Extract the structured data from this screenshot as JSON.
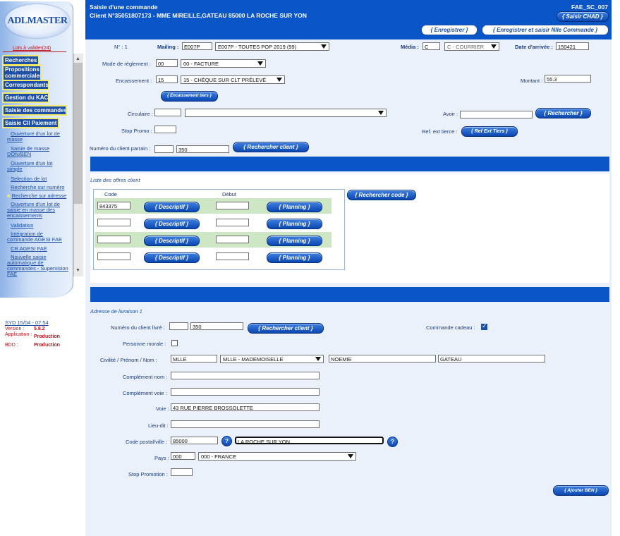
{
  "sidebar": {
    "logo_text": "ADLMASTER",
    "lots_link": "Lots à valider(24)",
    "nav": [
      "Recherches",
      "Propositions commerciales",
      "Correspondants",
      "Gestion du KAC",
      "Saisie des commandes",
      "Saisie Cll Paiement"
    ],
    "links": [
      "Ouverture d'un lot de masse",
      "Saisie de masse DON/BEN",
      "Ouverture d'un lot simple",
      "Selection de lot",
      "Recherche sur numéro",
      "Recherche sur adresse",
      "Ouverture d'un lot de saisie en masse des encaissements",
      "Validation",
      "Intégration de commande AGESI FAE",
      "CR AGESI FAE",
      "Nouvelle saisie automatique de commandes - Supervision FAE"
    ],
    "session": "SYD 15/04 - 07:54",
    "version_label": "Version :",
    "version_value": "5.8.2",
    "application_label": "Application :",
    "application_value": "Production",
    "bdd_label": "BDD :",
    "bdd_value": "Production"
  },
  "header": {
    "title": "Saisie d'une commande",
    "client": "Client N°35051807173 - MME MIREILLE,GATEAU 85000 LA ROCHE SUR YON",
    "code": "FAE_SC_007",
    "btn_chad": "{ Saisir CHAD }",
    "btn_save": "{ Enregistrer }",
    "btn_save_new": "{ Enregistrer et saisir Nlle Commande }"
  },
  "form": {
    "no_label": "N° : 1",
    "mailing_label": "Mailing :",
    "mailing_code": "E007P",
    "mailing_select": "E007P - TOUTES POP 2019 (99)",
    "media_label": "Média :",
    "media_code": "C",
    "media_select": "C - COURRIER",
    "arrival_label": "Date d'arrivée :",
    "arrival_value": "150421",
    "payment_mode_label": "Mode de règlement :",
    "payment_mode_code": "00",
    "payment_mode_select": "00 - FACTURE",
    "encaissement_label": "Encaissement :",
    "encaissement_code": "15",
    "encaissement_select": "15 - CHÈQUE SUR CLT PRÉLEVÉ",
    "montant_label": "Montant :",
    "montant_value": "55.3",
    "btn_enc_tiers": "{ Encaissement tiers }",
    "circulaire_label": "Circulaire :",
    "avoir_label": "Avoir :",
    "btn_rechercher": "{ Rechercher }",
    "stop_promo_label": "Stop Promo :",
    "ref_ext_label": "Ref. ext tierce :",
    "btn_ref_ext": "{ Ref Ext Tiers }",
    "parrain_label": "Numéro du client parrain :",
    "parrain_value": "350",
    "btn_rech_client": "{ Rechercher client }"
  },
  "offers": {
    "title": "Liste des offres client",
    "col_code": "Code",
    "col_debut": "Début",
    "btn_rech_code": "{ Rechercher code }",
    "btn_descriptif": "{ Descriptif }",
    "btn_planning": "{ Planning }",
    "rows": [
      {
        "code": "843375",
        "debut": ""
      },
      {
        "code": "",
        "debut": ""
      },
      {
        "code": "",
        "debut": ""
      },
      {
        "code": "",
        "debut": ""
      }
    ]
  },
  "delivery": {
    "title": "Adresse de livraison 1",
    "client_label": "Numéro du client livré :",
    "client_value": "350",
    "btn_rech_client": "{ Rechercher client }",
    "gift_label": "Commande cadeau :",
    "gift_checked": true,
    "morale_label": "Personne morale :",
    "morale_checked": false,
    "civility_label": "Civilité / Prénom / Nom :",
    "civility_code": "MLLE",
    "civility_select": "MLLE - MADEMOISELLE",
    "firstname": "NOEMIE",
    "lastname": "GATEAU",
    "complement_nom_label": "Complément nom :",
    "complement_voie_label": "Complément voie :",
    "voie_label": "Voie :",
    "voie_value": "43 RUE PIERRE BROSSOLETTE",
    "lieu_dit_label": "Lieu-dit :",
    "cp_label": "Code postal/ville :",
    "cp_value": "85000",
    "ville_value": "LA ROCHE SUR YON",
    "help": "?",
    "pays_label": "Pays :",
    "pays_code": "000",
    "pays_select": "000 - FRANCE",
    "stop_promo_label": "Stop Promotion :",
    "btn_add_ben": "{ Ajouter BEN }"
  }
}
